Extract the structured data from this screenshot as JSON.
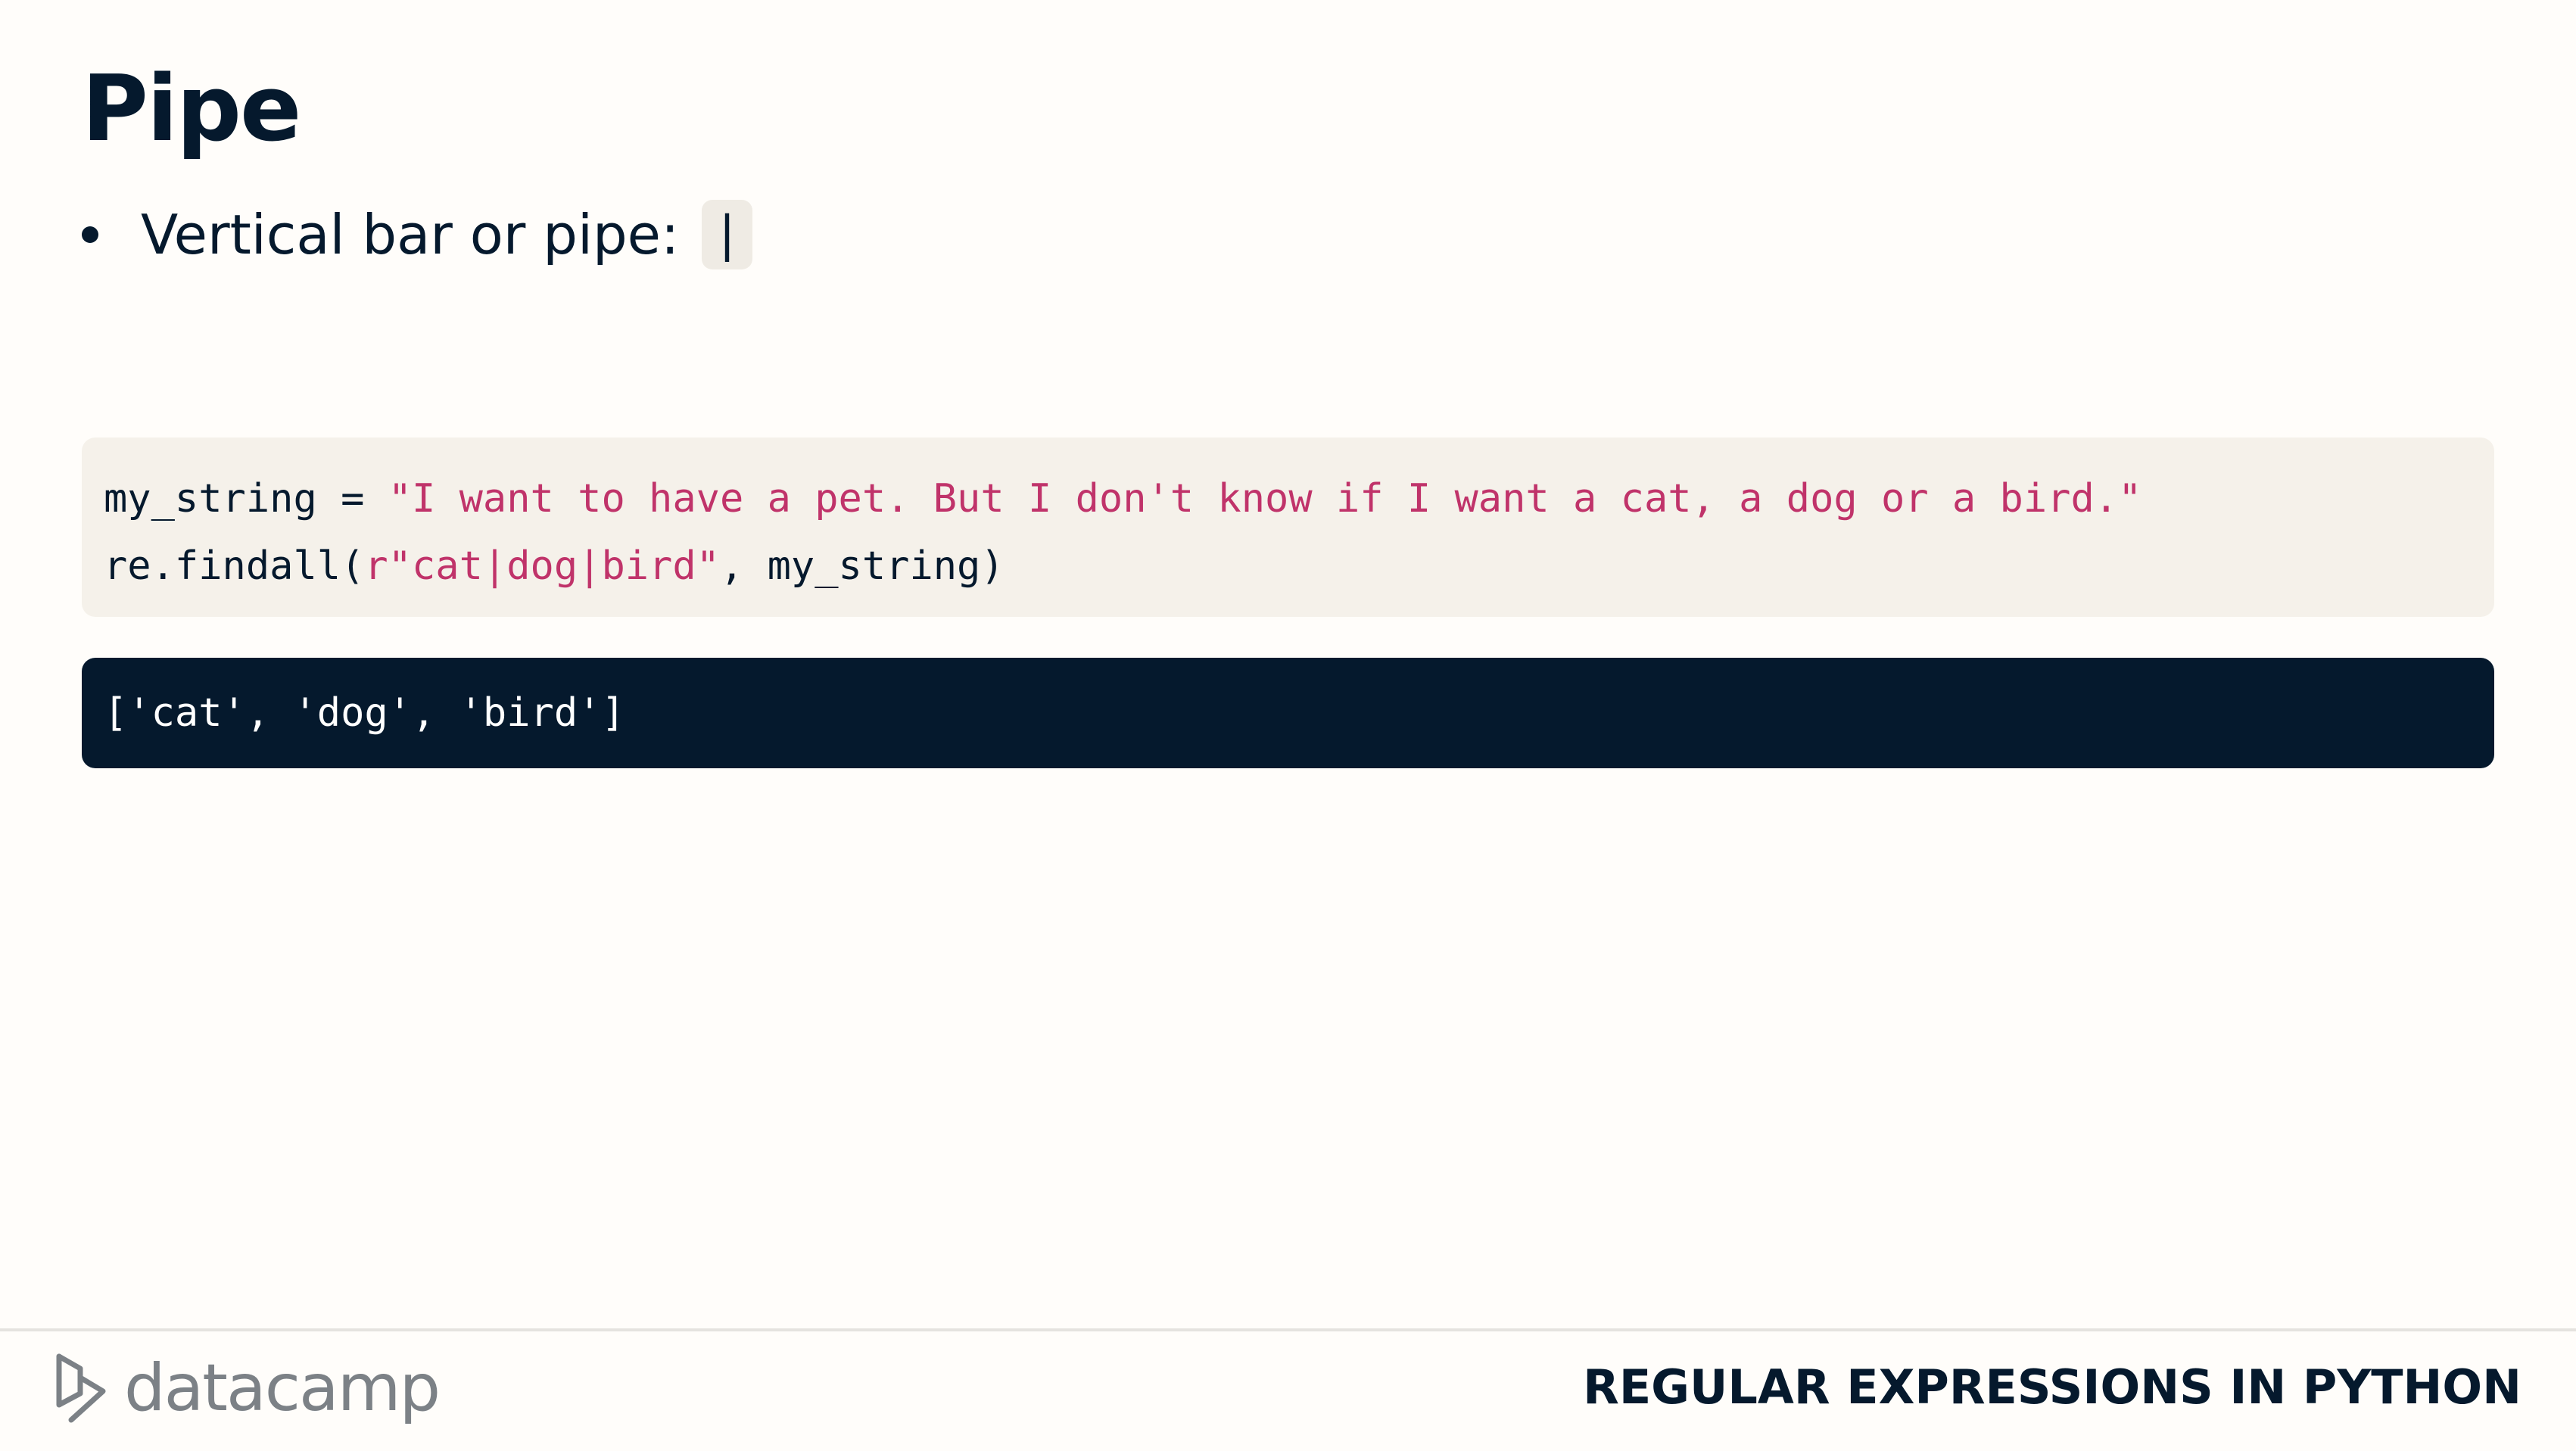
{
  "slide": {
    "title": "Pipe",
    "bullet": {
      "text": "Vertical bar or pipe:",
      "code": "|"
    }
  },
  "code_input": {
    "line1": {
      "plain1": "my_string = ",
      "string1": "\"I want to have a pet. But I don't know if I want a cat, a dog or a bird.\""
    },
    "line2": {
      "plain1": "re.findall(",
      "string1": "r\"cat|dog|bird\"",
      "plain2": ", my_string)"
    }
  },
  "code_output": {
    "text": "['cat', 'dog', 'bird']"
  },
  "footer": {
    "brand_name": "datacamp",
    "course_title": "REGULAR EXPRESSIONS IN PYTHON"
  },
  "colors": {
    "navy": "#05192d",
    "string": "#c0336a",
    "code_bg": "#f5f1ea",
    "brand_grey": "#7c8186"
  }
}
